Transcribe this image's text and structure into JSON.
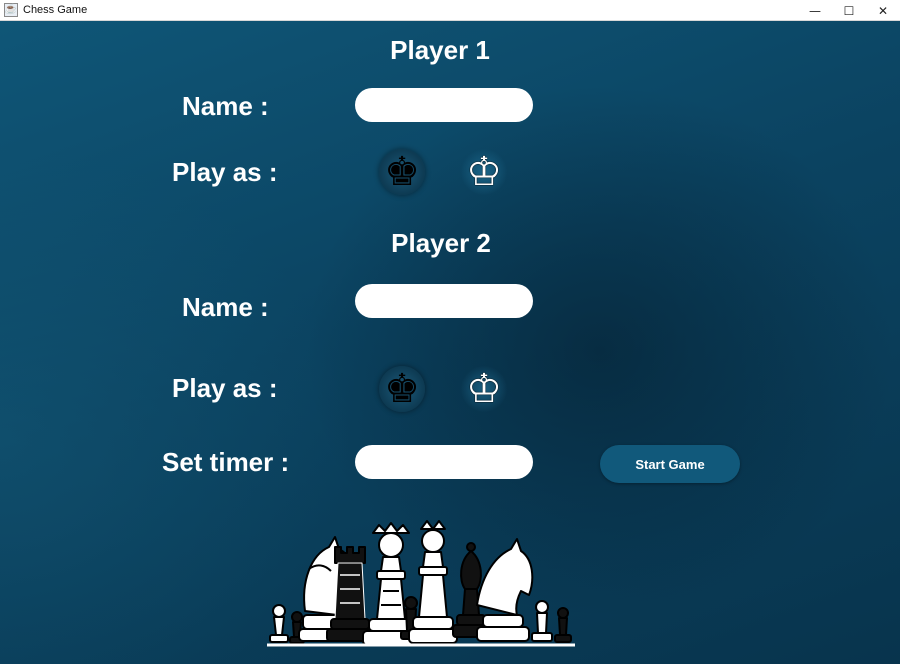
{
  "window": {
    "title": "Chess Game",
    "controls": [
      "—",
      "☐",
      "✕"
    ]
  },
  "player1": {
    "heading": "Player 1",
    "name_label": "Name :",
    "name_value": "",
    "play_as_label": "Play as :"
  },
  "player2": {
    "heading": "Player 2",
    "name_label": "Name :",
    "name_value": "",
    "play_as_label": "Play as :"
  },
  "timer": {
    "label": "Set timer :",
    "value": ""
  },
  "start_button": {
    "label": "Start Game"
  },
  "icons": {
    "black_king": "black-king-icon",
    "white_king": "white-king-icon",
    "black_king_glyph": "♚",
    "white_king_glyph": "♔"
  },
  "colors": {
    "background": "#0d3a52",
    "button": "#11597b",
    "text": "#ffffff"
  }
}
